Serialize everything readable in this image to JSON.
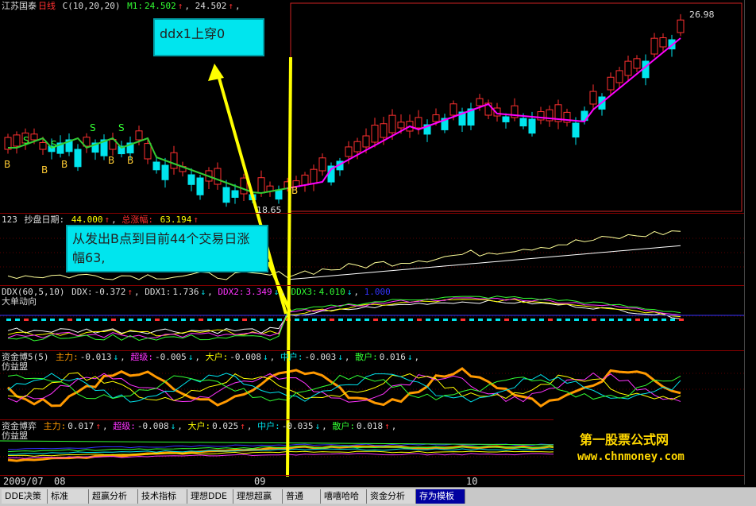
{
  "main_header": {
    "stock_name": "江苏国泰",
    "period": "日线",
    "ma_label": "C(10,20,20)",
    "m1_label": "M1:",
    "m1_value": "24.502",
    "m2_value": "24.502"
  },
  "price_labels": {
    "high": "26.98",
    "low": "18.65"
  },
  "signal_marks": {
    "buy": "B",
    "sell": "S"
  },
  "callouts": {
    "ddx": "ddx1上穿0",
    "gain": "从发出B点到目前44个交易日涨幅63,"
  },
  "pane2_header": {
    "code": "123",
    "label_days": "抄盘日期:",
    "days_value": "44.000",
    "label_gain": "总涨幅:",
    "gain_value": "63.194"
  },
  "pane3_header": {
    "code": "DDX(60,5,10)",
    "ddx_label": "DDX:",
    "ddx_value": "-0.372",
    "ddx1_label": "DDX1:",
    "ddx1_value": "1.736",
    "ddx2_label": "DDX2:",
    "ddx2_value": "3.349",
    "ddx3_label": "DDX3:",
    "ddx3_value": "4.010",
    "last_value": "1.000",
    "subtitle": "大单动向"
  },
  "pane4_header": {
    "code": "资金博5(5)",
    "zhuli_label": "主力:",
    "zhuli_value": "-0.013",
    "chaoji_label": "超级:",
    "chaoji_value": "-0.005",
    "dahu_label": "大户:",
    "dahu_value": "-0.008",
    "zhonghu_label": "中户:",
    "zhonghu_value": "-0.003",
    "sanhu_label": "散户:",
    "sanhu_value": "0.016",
    "subtitle": "仿益盟"
  },
  "pane5_header": {
    "code": "资金博弈",
    "zhuli_label": "主力:",
    "zhuli_value": "0.017",
    "chaoji_label": "超级:",
    "chaoji_value": "-0.008",
    "dahu_label": "大户:",
    "dahu_value": "0.025",
    "zhonghu_label": "中户:",
    "zhonghu_value": "-0.035",
    "sanhu_label": "散户:",
    "sanhu_value": "0.018",
    "subtitle": "仿益盟"
  },
  "time_axis": {
    "start": "2009/07",
    "m08": "08",
    "m09": "09",
    "m10": "10"
  },
  "watermark": {
    "name": "第一股票公式网",
    "url": "www.chnmoney.com"
  },
  "tabs": [
    "DDE决策",
    "标准",
    "超赢分析",
    "技术指标",
    "理想DDE",
    "理想超赢",
    "普通",
    "嘻嘻哈哈",
    "资金分析",
    "存为模板"
  ],
  "active_tab": "存为模板",
  "colors": {
    "up": "#ff3030",
    "down": "#00e5ee",
    "accent_yellow": "#ffff00",
    "ma_magenta": "#ff00ff",
    "ma_green": "#33cc33",
    "callout_bg": "#00e5ee"
  }
}
